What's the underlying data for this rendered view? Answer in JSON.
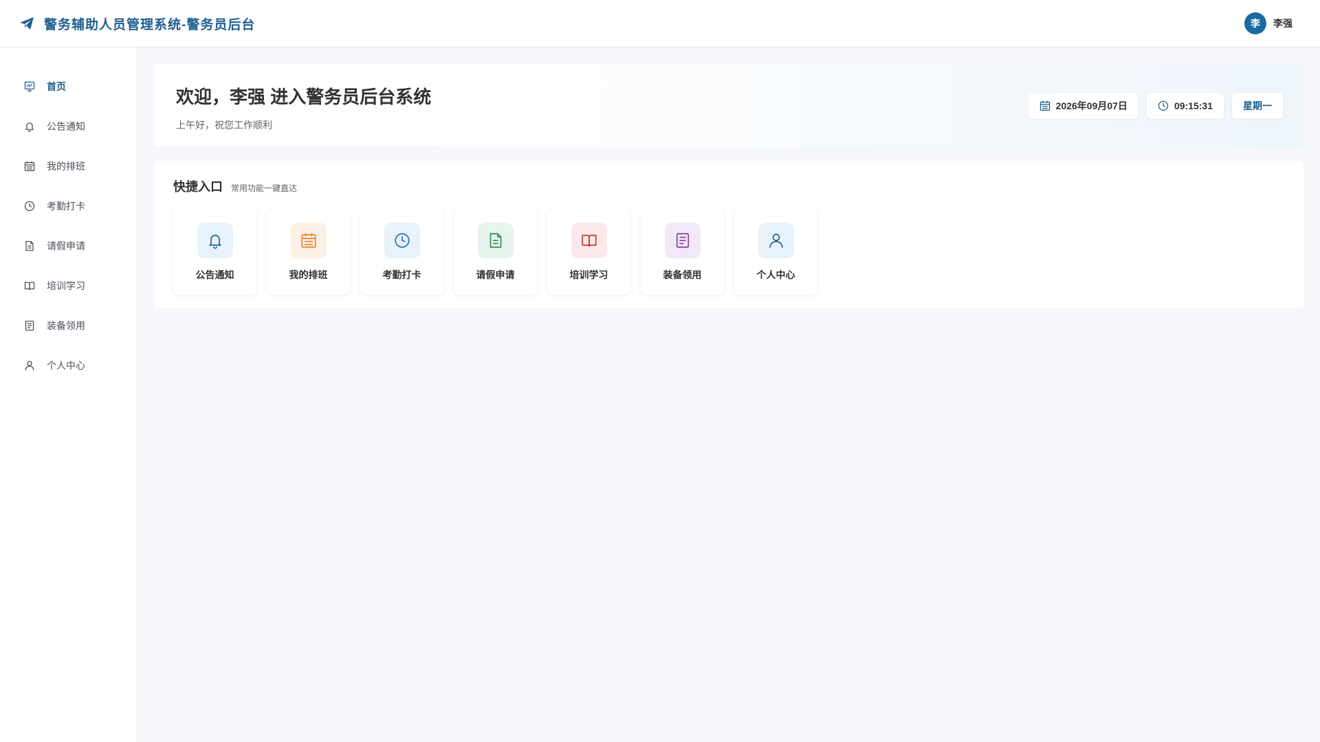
{
  "header": {
    "title": "警务辅助人员管理系统-警务员后台",
    "logo_icon": "paper-plane-icon",
    "brand_color": "#1f5f8f",
    "user": {
      "avatar_text": "李",
      "name": "李强"
    }
  },
  "sidebar": {
    "items": [
      {
        "label": "首页",
        "icon": "dashboard-chart-icon",
        "active": true
      },
      {
        "label": "公告通知",
        "icon": "bell-icon",
        "active": false
      },
      {
        "label": "我的排班",
        "icon": "calendar-icon",
        "active": false
      },
      {
        "label": "考勤打卡",
        "icon": "clock-icon",
        "active": false
      },
      {
        "label": "请假申请",
        "icon": "document-icon",
        "active": false
      },
      {
        "label": "培训学习",
        "icon": "book-icon",
        "active": false
      },
      {
        "label": "装备领用",
        "icon": "list-document-icon",
        "active": false
      },
      {
        "label": "个人中心",
        "icon": "user-icon",
        "active": false
      }
    ]
  },
  "welcome": {
    "title": "欢迎，李强 进入警务员后台系统",
    "subtitle": "上午好，祝您工作顺利",
    "date": "2026年09月07日",
    "time": "09:15:31",
    "weekday": "星期一"
  },
  "quick": {
    "title": "快捷入口",
    "subtitle": "常用功能一键直达",
    "tiles": [
      {
        "label": "公告通知",
        "icon": "bell-icon",
        "color": "#1f5f8f",
        "bg": "#e8f2fb"
      },
      {
        "label": "我的排班",
        "icon": "calendar-icon",
        "color": "#e6822e",
        "bg": "#fdf0e4"
      },
      {
        "label": "考勤打卡",
        "icon": "clock-icon",
        "color": "#1f6fa8",
        "bg": "#e8f2fb"
      },
      {
        "label": "请假申请",
        "icon": "document-icon",
        "color": "#2e8b57",
        "bg": "#e6f5ec"
      },
      {
        "label": "培训学习",
        "icon": "book-icon",
        "color": "#c0392b",
        "bg": "#fbe9e9"
      },
      {
        "label": "装备领用",
        "icon": "list-document-icon",
        "color": "#7b3fa0",
        "bg": "#f3e8f8"
      },
      {
        "label": "个人中心",
        "icon": "user-icon",
        "color": "#1f5f8f",
        "bg": "#e8f2fb"
      }
    ]
  }
}
